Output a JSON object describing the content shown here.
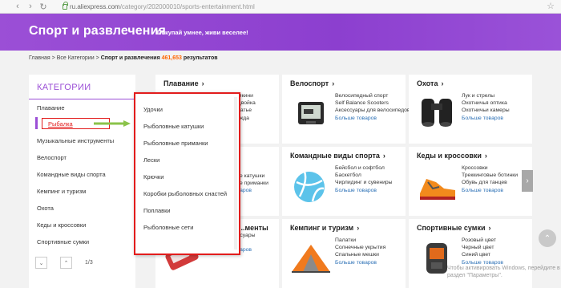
{
  "browser": {
    "url_host": "ru.aliexpress.com",
    "url_path": "/category/202000010/sports-entertainment.html",
    "back_icon": "chevron-left-icon",
    "forward_icon": "chevron-right-icon",
    "reload_icon": "reload-icon"
  },
  "hero": {
    "title": "Спорт и развлечения",
    "slogan": "Покупай умнее, живи веселее!"
  },
  "breadcrumb": {
    "home": "Главная",
    "all": "Все Категории",
    "current": "Спорт и развлечения",
    "count": "461,653",
    "results": "результатов"
  },
  "sidebar": {
    "heading": "КАТЕГОРИИ",
    "items": [
      "Плавание",
      "Рыбалка",
      "Музыкальные инструменты",
      "Велоспорт",
      "Командные виды спорта",
      "Кемпинг и туризм",
      "Охота",
      "Кеды и кроссовки",
      "Спортивные сумки"
    ],
    "page": "1/3"
  },
  "dropdown": {
    "items": [
      "Удочки",
      "Рыболовные катушки",
      "Рыболовные приманки",
      "Лески",
      "Крючки",
      "Коробки рыболовных снастей",
      "Поплавки",
      "Рыболовные сети"
    ]
  },
  "grid": {
    "swim": {
      "title": "Плавание",
      "links": [
        "Комплект бикини",
        "Купальник двойка",
        "Пляжное платье",
        "Фитнес-одежда"
      ]
    },
    "cycling": {
      "title": "Велоспорт",
      "links": [
        "Велосипедный спорт",
        "Self Balance Scooters",
        "Аксессуары для велосипедов"
      ],
      "more": "Больше товаров"
    },
    "hunting": {
      "title": "Охота",
      "links": [
        "Лук и стрелы",
        "Охотничья оптика",
        "Охотничьи камеры"
      ],
      "more": "Больше товаров"
    },
    "fish_mid": {
      "links": [
        "Рыболовные катушки",
        "Рыболовные приманки"
      ],
      "more": "Больше товаров"
    },
    "team": {
      "title": "Командные виды спорта",
      "links": [
        "Бейсбол и софтбол",
        "Баскетбол",
        "Чирлидинг и сувениры"
      ],
      "more": "Больше товаров"
    },
    "shoes": {
      "title": "Кеды и кроссовки",
      "links": [
        "Кроссовки",
        "Треккинговые ботинки",
        "Обувь для танцев"
      ],
      "more": "Больше товаров"
    },
    "instruments": {
      "title": "...менты",
      "links": [
        "Гитары и оссуары",
        "Скрипки"
      ],
      "more": "Больше товаров"
    },
    "camping": {
      "title": "Кемпинг и туризм",
      "links": [
        "Палатки",
        "Солнечные укрытия",
        "Спальные мешки"
      ],
      "more": "Больше товаров"
    },
    "bags": {
      "title": "Спортивные сумки",
      "links": [
        "Розовый цвет",
        "Черный цвет",
        "Синий цвет"
      ],
      "more": "Больше товаров"
    }
  },
  "watermark": {
    "line1": "Чтобы активировать Windows, перейдите в",
    "line2": "раздел \"Параметры\"."
  },
  "colors": {
    "purple": "#9b4fd6",
    "highlight_red": "#e21c1c",
    "link_blue": "#2a6fb5",
    "arrow_green": "#8bc34a"
  }
}
